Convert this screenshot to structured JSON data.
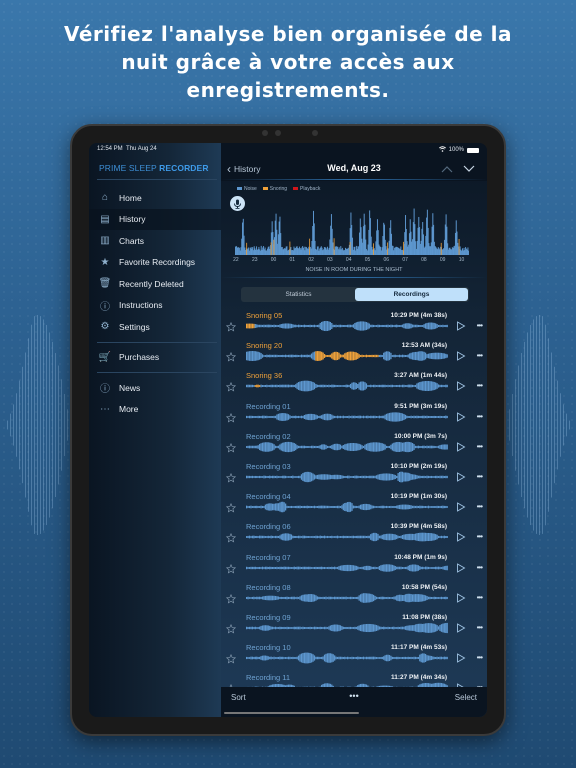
{
  "headline": [
    "Vérifiez l'analyse bien organisée de la",
    "nuit grâce à votre accès aux",
    "enregistrements."
  ],
  "status_bar": {
    "time": "12:54 PM",
    "date": "Thu Aug 24",
    "battery": "100%"
  },
  "sidebar": {
    "brand_light": "PRIME SLEEP",
    "brand_bold": "RECORDER",
    "items": [
      {
        "label": "Home",
        "icon": "home-icon"
      },
      {
        "label": "History",
        "icon": "history-icon",
        "active": true
      },
      {
        "label": "Charts",
        "icon": "charts-icon"
      },
      {
        "label": "Favorite Recordings",
        "icon": "star-icon"
      },
      {
        "label": "Recently Deleted",
        "icon": "trash-icon"
      },
      {
        "label": "Instructions",
        "icon": "info-icon"
      },
      {
        "label": "Settings",
        "icon": "gear-icon"
      }
    ],
    "items2": [
      {
        "label": "Purchases",
        "icon": "cart-icon"
      }
    ],
    "items3": [
      {
        "label": "News",
        "icon": "news-icon"
      },
      {
        "label": "More",
        "icon": "more-icon"
      }
    ]
  },
  "header": {
    "back_label": "History",
    "title": "Wed, Aug 23"
  },
  "legend": [
    {
      "label": "Noise",
      "color": "#5d97cf"
    },
    {
      "label": "Snoring",
      "color": "#f0a23a"
    },
    {
      "label": "Playback",
      "color": "#d0161b"
    }
  ],
  "chart_data": {
    "type": "bar",
    "title": "",
    "xlabel": "NOISE IN ROOM DURING THE NIGHT",
    "ylabel": "",
    "categories": [
      "22",
      "23",
      "00",
      "01",
      "02",
      "03",
      "04",
      "05",
      "06",
      "07",
      "08",
      "09",
      "10"
    ],
    "series": [
      {
        "name": "Noise",
        "peaks": [
          {
            "t": 22.35,
            "v": 0.75
          },
          {
            "t": 23.9,
            "v": 0.65
          },
          {
            "t": 24.1,
            "v": 0.9
          },
          {
            "t": 24.3,
            "v": 0.85
          },
          {
            "t": 26.1,
            "v": 0.9
          },
          {
            "t": 27.05,
            "v": 0.85
          },
          {
            "t": 28.1,
            "v": 0.85
          },
          {
            "t": 28.6,
            "v": 0.75
          },
          {
            "t": 28.8,
            "v": 0.85
          },
          {
            "t": 29.1,
            "v": 0.9
          },
          {
            "t": 29.5,
            "v": 0.75
          },
          {
            "t": 29.85,
            "v": 0.7
          },
          {
            "t": 30.2,
            "v": 0.75
          },
          {
            "t": 31.0,
            "v": 0.75
          },
          {
            "t": 31.25,
            "v": 0.7
          },
          {
            "t": 31.45,
            "v": 0.9
          },
          {
            "t": 31.7,
            "v": 0.8
          },
          {
            "t": 31.9,
            "v": 0.65
          },
          {
            "t": 32.15,
            "v": 0.95
          },
          {
            "t": 32.45,
            "v": 0.85
          },
          {
            "t": 33.15,
            "v": 0.85
          },
          {
            "t": 33.7,
            "v": 0.7
          }
        ],
        "baseline": 0.15
      },
      {
        "name": "Snoring",
        "ticks": [
          22.55,
          23.85,
          24.0,
          24.85,
          25.9,
          27.2,
          28.05,
          29.3,
          30.05,
          30.9,
          32.9,
          33.85
        ]
      }
    ],
    "xlim": [
      21.95,
      34.4
    ],
    "ylim": [
      0,
      1
    ]
  },
  "segmented": {
    "options": [
      "Statistics",
      "Recordings"
    ],
    "selected": "Recordings"
  },
  "recordings": [
    {
      "name": "Snoring 05",
      "time": "10:29 PM (4m 38s)",
      "snore": true,
      "seed": 5,
      "snore_ranges": [
        [
          0.0,
          0.04
        ]
      ]
    },
    {
      "name": "Snoring 20",
      "time": "12:53 AM (34s)",
      "snore": true,
      "seed": 20,
      "snore_ranges": [
        [
          0.34,
          0.65
        ]
      ]
    },
    {
      "name": "Snoring 36",
      "time": "3:27 AM (1m 44s)",
      "snore": true,
      "seed": 36,
      "snore_ranges": [
        [
          0.04,
          0.07
        ]
      ]
    },
    {
      "name": "Recording 01",
      "time": "9:51 PM (3m 19s)",
      "seed": 1
    },
    {
      "name": "Recording 02",
      "time": "10:00 PM (3m 7s)",
      "seed": 2
    },
    {
      "name": "Recording 03",
      "time": "10:10 PM (2m 19s)",
      "seed": 3
    },
    {
      "name": "Recording 04",
      "time": "10:19 PM (1m 30s)",
      "seed": 4
    },
    {
      "name": "Recording 06",
      "time": "10:39 PM (4m 58s)",
      "seed": 6
    },
    {
      "name": "Recording 07",
      "time": "10:48 PM (1m 9s)",
      "seed": 7
    },
    {
      "name": "Recording 08",
      "time": "10:58 PM (54s)",
      "seed": 8
    },
    {
      "name": "Recording 09",
      "time": "11:08 PM (38s)",
      "seed": 9
    },
    {
      "name": "Recording 10",
      "time": "11:17 PM (4m 53s)",
      "seed": 10
    },
    {
      "name": "Recording 11",
      "time": "11:27 PM (4m 34s)",
      "seed": 11
    }
  ],
  "toolbar": {
    "sort": "Sort",
    "more": "•••",
    "select": "Select"
  }
}
